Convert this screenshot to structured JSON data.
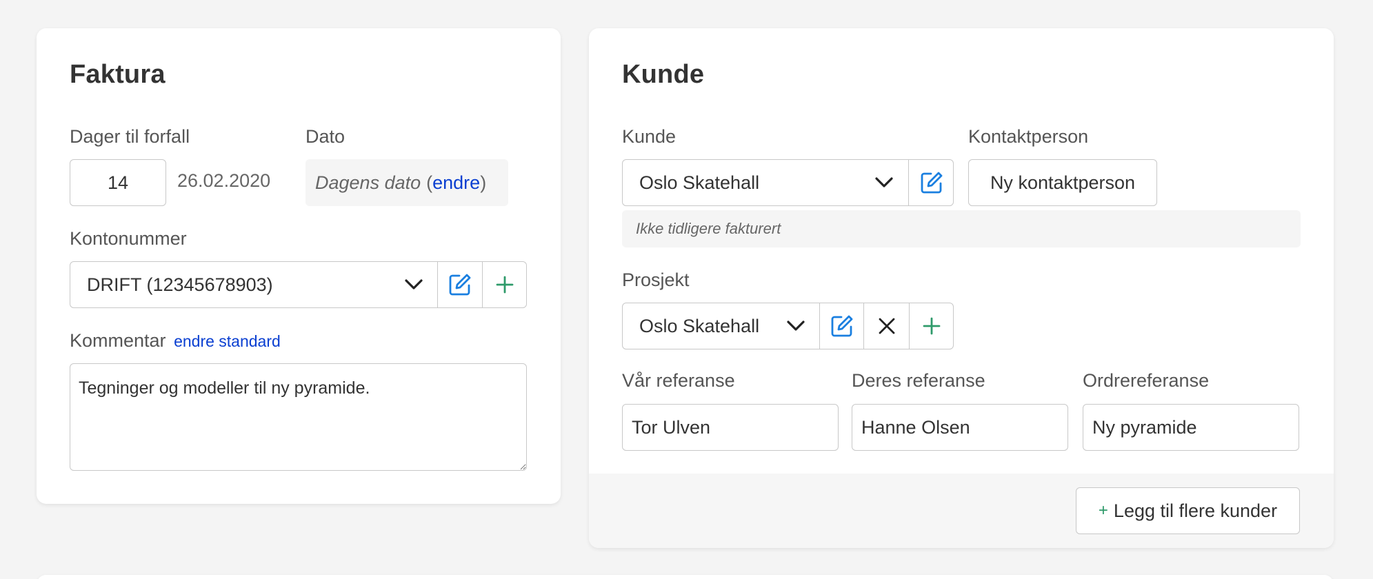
{
  "faktura": {
    "title": "Faktura",
    "due_days_label": "Dager til forfall",
    "due_days_value": "14",
    "due_date": "26.02.2020",
    "date_label": "Dato",
    "date_value_text": "Dagens dato",
    "date_paren_open": "(",
    "date_change_link": "endre",
    "date_paren_close": ")",
    "account_label": "Kontonummer",
    "account_value": "DRIFT (12345678903)",
    "comment_label": "Kommentar",
    "comment_link": "endre standard",
    "comment_value": "Tegninger og modeller til ny pyramide."
  },
  "kunde": {
    "title": "Kunde",
    "customer_label": "Kunde",
    "customer_value": "Oslo Skatehall",
    "contact_label": "Kontaktperson",
    "contact_button": "Ny kontaktperson",
    "invoice_note": "Ikke tidligere fakturert",
    "project_label": "Prosjekt",
    "project_value": "Oslo Skatehall",
    "our_ref_label": "Vår referanse",
    "our_ref_value": "Tor Ulven",
    "their_ref_label": "Deres referanse",
    "their_ref_value": "Hanne Olsen",
    "order_ref_label": "Ordrereferanse",
    "order_ref_value": "Ny pyramide",
    "add_customers_plus": "+",
    "add_customers_button": "Legg til flere kunder"
  },
  "colors": {
    "link": "#0a3fd1",
    "edit_icon": "#1a7fe0",
    "add_icon": "#2e9a6a",
    "border": "#c8c8c8",
    "background": "#f4f4f4"
  },
  "icons": [
    "chevron-down-icon",
    "edit-icon",
    "plus-icon",
    "close-icon"
  ]
}
